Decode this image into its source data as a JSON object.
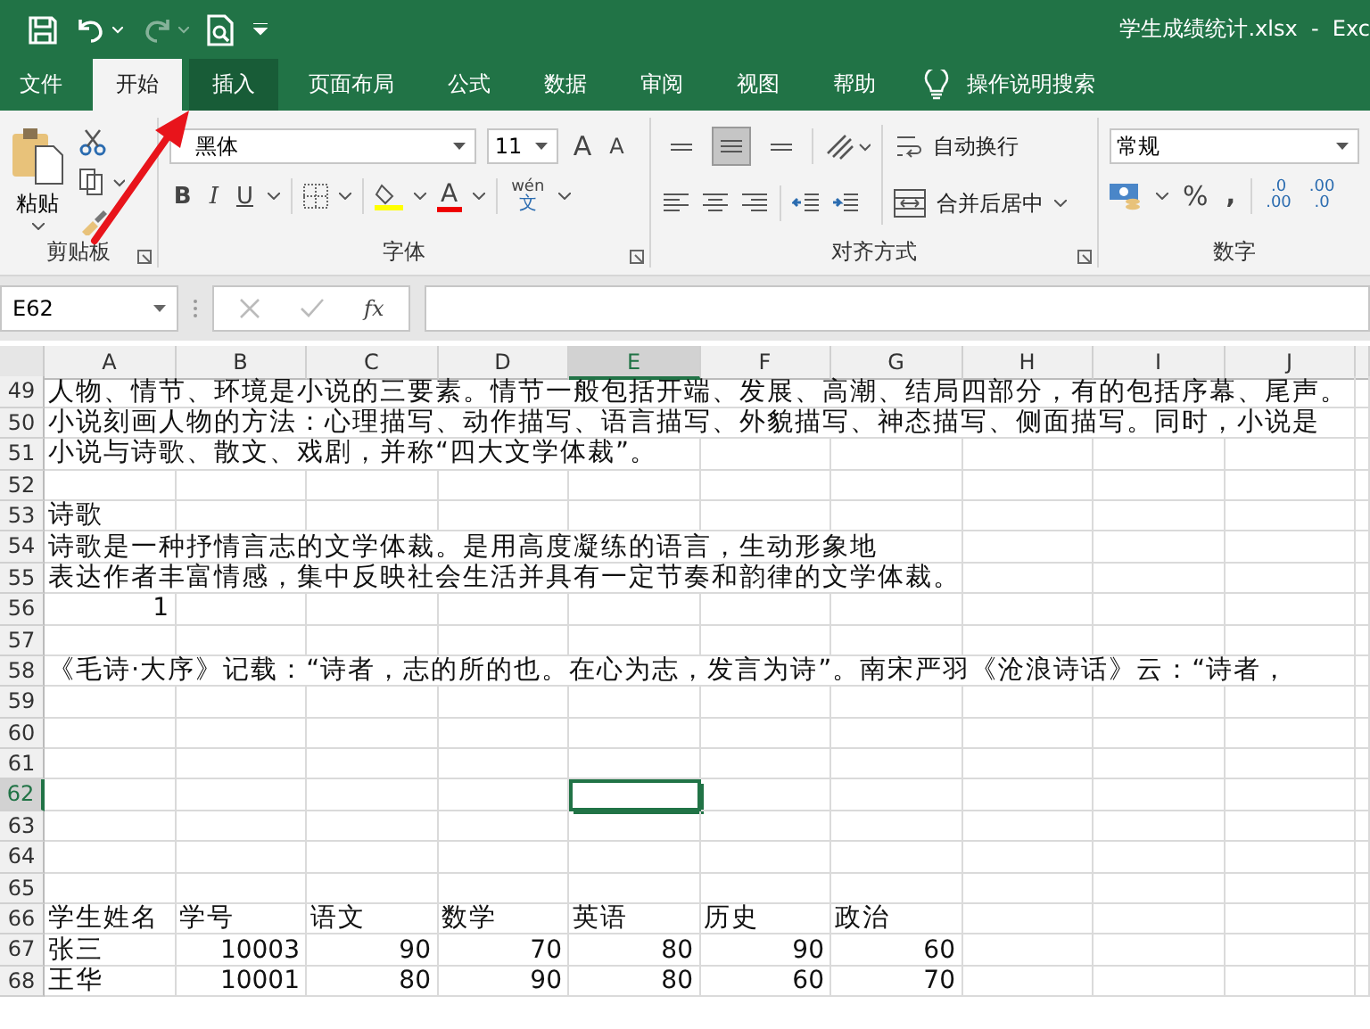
{
  "title_bar": {
    "title": "学生成绩统计.xlsx  -  Exc"
  },
  "tabs": [
    {
      "label": "文件",
      "selected": false,
      "highlighted": false
    },
    {
      "label": "开始",
      "selected": true,
      "highlighted": false
    },
    {
      "label": "插入",
      "selected": false,
      "highlighted": true
    },
    {
      "label": "页面布局",
      "selected": false,
      "highlighted": false
    },
    {
      "label": "公式",
      "selected": false,
      "highlighted": false
    },
    {
      "label": "数据",
      "selected": false,
      "highlighted": false
    },
    {
      "label": "审阅",
      "selected": false,
      "highlighted": false
    },
    {
      "label": "视图",
      "selected": false,
      "highlighted": false
    },
    {
      "label": "帮助",
      "selected": false,
      "highlighted": false
    }
  ],
  "tell_me": "操作说明搜索",
  "ribbon": {
    "clipboard": {
      "paste": "粘贴",
      "label": "剪贴板"
    },
    "font": {
      "font_name": "黑体",
      "font_size": "11",
      "grow": "A",
      "shrink": "A",
      "bold": "B",
      "italic": "I",
      "underline": "U",
      "font_color": "A",
      "phonetic_top": "wén",
      "phonetic_bottom": "文",
      "label": "字体"
    },
    "alignment": {
      "vertical": [
        {
          "selected": false
        },
        {
          "selected": true
        },
        {
          "selected": false
        }
      ],
      "wrap_text": "自动换行",
      "merge_center": "合并后居中",
      "label": "对齐方式"
    },
    "number": {
      "format": "常规",
      "percent": "%",
      "comma": ",",
      "increase_decimal": [
        ".0",
        ".00"
      ],
      "decrease_decimal": [
        ".00",
        ".0"
      ],
      "label": "数字"
    }
  },
  "formula_bar": {
    "name_box": "E62",
    "function_label": "fx"
  },
  "columns": [
    {
      "label": "A",
      "selected": false
    },
    {
      "label": "B",
      "selected": false
    },
    {
      "label": "C",
      "selected": false
    },
    {
      "label": "D",
      "selected": false
    },
    {
      "label": "E",
      "selected": true
    },
    {
      "label": "F",
      "selected": false
    },
    {
      "label": "G",
      "selected": false
    },
    {
      "label": "H",
      "selected": false
    },
    {
      "label": "I",
      "selected": false
    },
    {
      "label": "J",
      "selected": false
    }
  ],
  "rows": [
    {
      "label": "49",
      "selected": false,
      "cells": [
        {
          "kind": "text",
          "text": "人物、情节、环境是小说的三要素。情节一般包括开端、发展、高潮、结局四部分，有的包括序幕、尾声。"
        }
      ]
    },
    {
      "label": "50",
      "selected": false,
      "cells": [
        {
          "kind": "text",
          "text": "小说刻画人物的方法：心理描写、动作描写、语言描写、外貌描写、神态描写、侧面描写。同时，小说是"
        }
      ]
    },
    {
      "label": "51",
      "selected": false,
      "cells": [
        {
          "kind": "text",
          "text": "小说与诗歌、散文、戏剧，并称“四大文学体裁”。"
        }
      ]
    },
    {
      "label": "52",
      "selected": false,
      "cells": []
    },
    {
      "label": "53",
      "selected": false,
      "cells": [
        {
          "kind": "text",
          "text": "诗歌"
        }
      ]
    },
    {
      "label": "54",
      "selected": false,
      "cells": [
        {
          "kind": "text",
          "text": "诗歌是一种抒情言志的文学体裁。是用高度凝练的语言，生动形象地"
        }
      ]
    },
    {
      "label": "55",
      "selected": false,
      "cells": [
        {
          "kind": "text",
          "text": "表达作者丰富情感，集中反映社会生活并具有一定节奏和韵律的文学体裁。"
        }
      ]
    },
    {
      "label": "56",
      "selected": false,
      "cells": [
        {
          "kind": "number",
          "text": "1"
        }
      ]
    },
    {
      "label": "57",
      "selected": false,
      "cells": []
    },
    {
      "label": "58",
      "selected": false,
      "cells": [
        {
          "kind": "text",
          "text": "《毛诗·大序》记载：“诗者，志的所的也。在心为志，发言为诗”。南宋严羽《沧浪诗话》云：“诗者，"
        }
      ]
    },
    {
      "label": "59",
      "selected": false,
      "cells": []
    },
    {
      "label": "60",
      "selected": false,
      "cells": []
    },
    {
      "label": "61",
      "selected": false,
      "cells": []
    },
    {
      "label": "62",
      "selected": true,
      "cells": []
    },
    {
      "label": "63",
      "selected": false,
      "cells": []
    },
    {
      "label": "64",
      "selected": false,
      "cells": []
    },
    {
      "label": "65",
      "selected": false,
      "cells": []
    },
    {
      "label": "66",
      "selected": false,
      "cells": [
        {
          "kind": "text",
          "text": "学生姓名"
        },
        {
          "kind": "text",
          "text": "学号"
        },
        {
          "kind": "text",
          "text": "语文"
        },
        {
          "kind": "text",
          "text": "数学"
        },
        {
          "kind": "text",
          "text": "英语"
        },
        {
          "kind": "text",
          "text": "历史"
        },
        {
          "kind": "text",
          "text": "政治"
        }
      ]
    },
    {
      "label": "67",
      "selected": false,
      "cells": [
        {
          "kind": "text",
          "text": "张三"
        },
        {
          "kind": "number",
          "text": "10003"
        },
        {
          "kind": "number",
          "text": "90"
        },
        {
          "kind": "number",
          "text": "70"
        },
        {
          "kind": "number",
          "text": "80"
        },
        {
          "kind": "number",
          "text": "90"
        },
        {
          "kind": "number",
          "text": "60"
        }
      ]
    },
    {
      "label": "68",
      "selected": false,
      "cells": [
        {
          "kind": "text",
          "text": "王华"
        },
        {
          "kind": "number",
          "text": "10001"
        },
        {
          "kind": "number",
          "text": "80"
        },
        {
          "kind": "number",
          "text": "90"
        },
        {
          "kind": "number",
          "text": "80"
        },
        {
          "kind": "number",
          "text": "60"
        },
        {
          "kind": "number",
          "text": "70"
        }
      ]
    }
  ]
}
